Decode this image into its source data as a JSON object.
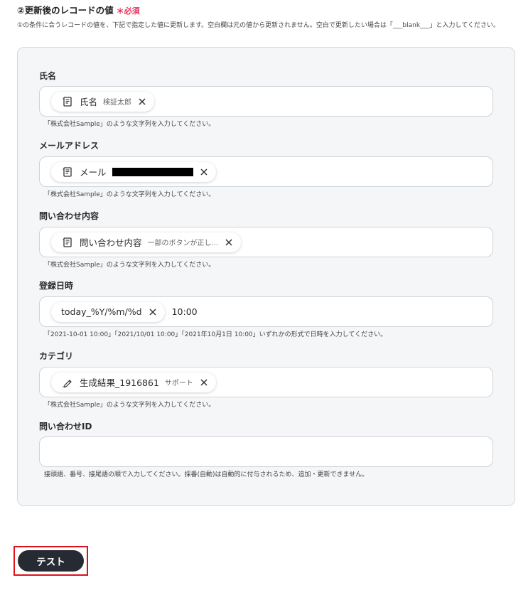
{
  "section": {
    "title": "②更新後のレコードの値",
    "required_mark": "＊必須",
    "description": "①の条件に合うレコードの値を、下記で指定した値に更新します。空白欄は元の値から更新されません。空白で更新したい場合は「___blank___」と入力してください。"
  },
  "fields": [
    {
      "label": "氏名",
      "chip": {
        "icon": "document-icon",
        "name": "氏名",
        "sub": "検証太郎"
      },
      "hint": "「株式会社Sample」のような文字列を入力してください。"
    },
    {
      "label": "メールアドレス",
      "chip": {
        "icon": "document-icon",
        "name": "メール",
        "redacted": true
      },
      "hint": "「株式会社Sample」のような文字列を入力してください。"
    },
    {
      "label": "問い合わせ内容",
      "chip": {
        "icon": "document-icon",
        "name": "問い合わせ内容",
        "sub": "一部のボタンが正し..."
      },
      "hint": "「株式会社Sample」のような文字列を入力してください。"
    },
    {
      "label": "登録日時",
      "chip": {
        "name": "today_%Y/%m/%d"
      },
      "after_text": "10:00",
      "hint": "「2021-10-01 10:00」「2021/10/01 10:00」「2021年10月1日 10:00」いずれかの形式で日時を入力してください。"
    },
    {
      "label": "カテゴリ",
      "chip": {
        "icon": "pen-icon",
        "name": "生成結果_1916861",
        "sub": "サポート"
      },
      "hint": "「株式会社Sample」のような文字列を入力してください。"
    },
    {
      "label": "問い合わせID",
      "value": "",
      "hint": "接頭語、番号、接尾語の順で入力してください。採番(自動)は自動的に付与されるため、追加・更新できません。"
    }
  ],
  "buttons": {
    "test_label": "テスト"
  },
  "colors": {
    "required": "#e8335a",
    "button_bg": "#262a33",
    "highlight": "#e0101a"
  }
}
